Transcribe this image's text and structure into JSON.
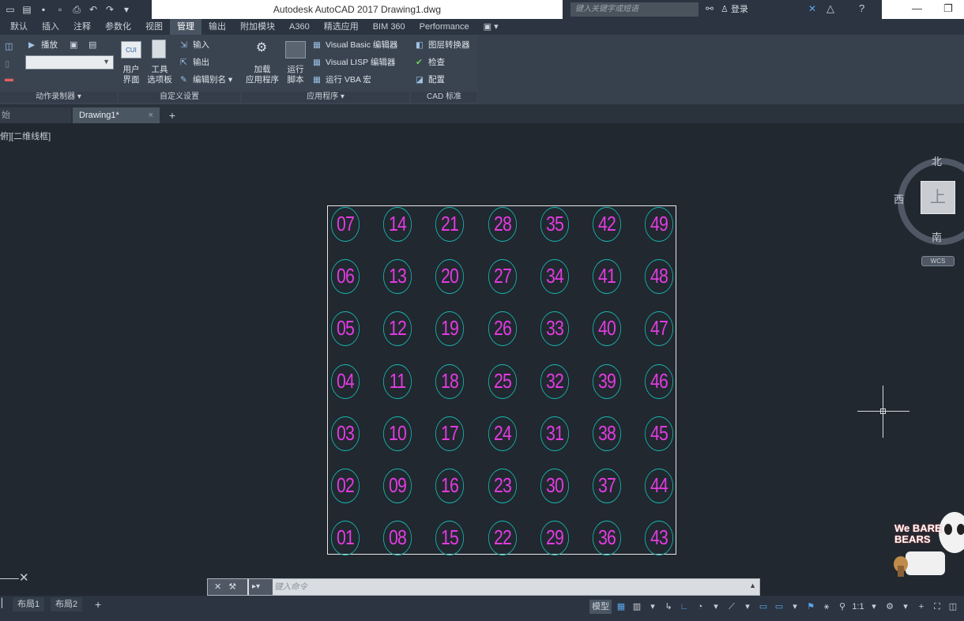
{
  "window": {
    "title": "Autodesk AutoCAD 2017    Drawing1.dwg",
    "search_placeholder": "键入关键字或短语",
    "login_label": "登录"
  },
  "menu_tabs": [
    "默认",
    "插入",
    "注释",
    "参数化",
    "视图",
    "管理",
    "输出",
    "附加模块",
    "A360",
    "精选应用",
    "BIM 360",
    "Performance"
  ],
  "active_tab_index": 5,
  "ribbon": {
    "action_recorder": {
      "play": "播放",
      "title": "动作录制器"
    },
    "customization": {
      "user_interface": "用户\n界面",
      "tool_palettes": "工具\n选项板",
      "import": "输入",
      "export": "输出",
      "edit_aliases": "编辑别名",
      "title": "自定义设置",
      "cui_badge": "CUI"
    },
    "applications": {
      "load_app": "加载\n应用程序",
      "run_script": "运行\n脚本",
      "vb_editor": "Visual Basic 编辑器",
      "lisp_editor": "Visual LISP 编辑器",
      "run_vba": "运行 VBA 宏",
      "title": "应用程序"
    },
    "cad_standards": {
      "layer_translator": "图层转换器",
      "check": "检查",
      "configure": "配置",
      "title": "CAD 标准"
    }
  },
  "file_tabs": {
    "start": "始",
    "drawing": "Drawing1*",
    "close": "×",
    "add": "+"
  },
  "canvas": {
    "viewport_label": "俯][二维线框]",
    "cells": [
      [
        "07",
        "14",
        "21",
        "28",
        "35",
        "42",
        "49"
      ],
      [
        "06",
        "13",
        "20",
        "27",
        "34",
        "41",
        "48"
      ],
      [
        "05",
        "12",
        "19",
        "26",
        "33",
        "40",
        "47"
      ],
      [
        "04",
        "11",
        "18",
        "25",
        "32",
        "39",
        "46"
      ],
      [
        "03",
        "10",
        "17",
        "24",
        "31",
        "38",
        "45"
      ],
      [
        "02",
        "09",
        "16",
        "23",
        "30",
        "37",
        "44"
      ],
      [
        "01",
        "08",
        "15",
        "22",
        "29",
        "36",
        "43"
      ]
    ],
    "circle_color": "#19b8b0",
    "number_color": "#e23be0"
  },
  "viewcube": {
    "face": "上",
    "north": "北",
    "south": "南",
    "west": "西",
    "wcs": "WCS"
  },
  "command_line": {
    "placeholder": "键入命令"
  },
  "status_bar": {
    "layout_tabs": [
      "布局1",
      "布局2"
    ],
    "model": "模型",
    "scale": "1:1"
  },
  "watermark": {
    "text": "We BARE BEARS"
  }
}
